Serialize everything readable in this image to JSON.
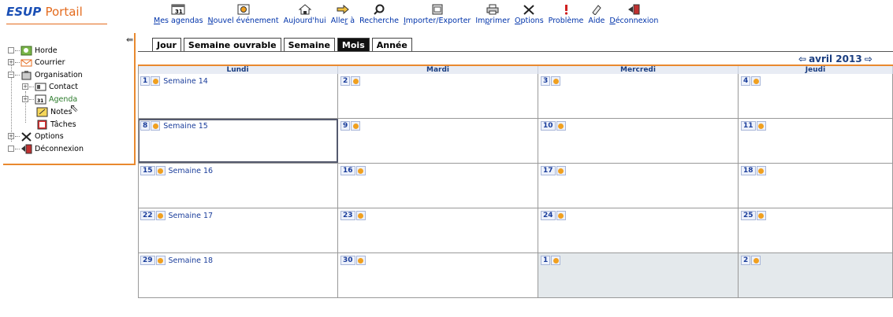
{
  "brand": {
    "esup": "ESUP",
    "portail": "Portail"
  },
  "toolbar": [
    {
      "name": "mes-agendas",
      "pre": "",
      "u": "M",
      "post": "es agendas",
      "icon": "calendar-icon"
    },
    {
      "name": "nouvel-evenement",
      "pre": "",
      "u": "N",
      "post": "ouvel événement",
      "icon": "new-event-icon"
    },
    {
      "name": "aujourdhui",
      "pre": "",
      "u": "",
      "post": "Aujourd'hui",
      "icon": "today-icon"
    },
    {
      "name": "aller-a",
      "pre": "Alle",
      "u": "r",
      "post": " à",
      "icon": "goto-icon"
    },
    {
      "name": "recherche",
      "pre": "",
      "u": "",
      "post": "Recherche",
      "icon": "search-icon"
    },
    {
      "name": "importer-exporter",
      "pre": "",
      "u": "I",
      "post": "mporter/Exporter",
      "icon": "import-export-icon"
    },
    {
      "name": "imprimer",
      "pre": "Im",
      "u": "p",
      "post": "rimer",
      "icon": "print-icon"
    },
    {
      "name": "options",
      "pre": "",
      "u": "O",
      "post": "ptions",
      "icon": "options-icon"
    },
    {
      "name": "probleme",
      "pre": "",
      "u": "",
      "post": "Problème",
      "icon": "problem-icon"
    },
    {
      "name": "aide",
      "pre": "",
      "u": "",
      "post": "Aide",
      "icon": "help-icon"
    },
    {
      "name": "deconnexion",
      "pre": "",
      "u": "D",
      "post": "éconnexion",
      "icon": "logout-icon"
    }
  ],
  "sidebar": {
    "horde": "Horde",
    "courrier": "Courrier",
    "organisation": "Organisation",
    "contact": "Contact",
    "agenda": "Agenda",
    "notes": "Notes",
    "taches": "Tâches",
    "options": "Options",
    "deconnexion": "Déconnexion"
  },
  "tabs": {
    "jour": "Jour",
    "semaine_ouvrable": "Semaine ouvrable",
    "semaine": "Semaine",
    "mois": "Mois",
    "annee": "Année"
  },
  "month_label": "avril 2013",
  "days": {
    "lundi": "Lundi",
    "mardi": "Mardi",
    "mercredi": "Mercredi",
    "jeudi": "Jeudi"
  },
  "weeks": [
    {
      "label": "Semaine 14",
      "days": [
        "1",
        "2",
        "3",
        "4"
      ]
    },
    {
      "label": "Semaine 15",
      "days": [
        "8",
        "9",
        "10",
        "11"
      ]
    },
    {
      "label": "Semaine 16",
      "days": [
        "15",
        "16",
        "17",
        "18"
      ]
    },
    {
      "label": "Semaine 17",
      "days": [
        "22",
        "23",
        "24",
        "25"
      ]
    },
    {
      "label": "Semaine 18",
      "days": [
        "29",
        "30",
        "1",
        "2"
      ]
    }
  ],
  "colors": {
    "accent": "#e9892f",
    "link": "#1a3d9b",
    "other_month": "#e4e9ec"
  }
}
